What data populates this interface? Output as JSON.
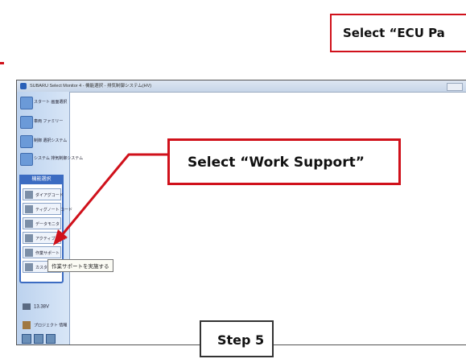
{
  "callouts": {
    "top": "Select “ECU Pa",
    "mid": "Select “Work Support”",
    "step": "Step 5"
  },
  "window": {
    "title": "SUBARU Select Monitor 4 - 機能選択 - 排気制御システム(HV)"
  },
  "sidebar": {
    "nav": [
      {
        "label": "スタート 画面選択",
        "icon": "home-icon"
      },
      {
        "label": "車両 ファミリー",
        "icon": "car-icon"
      },
      {
        "label": "制御 選択システム",
        "icon": "system-icon"
      },
      {
        "label": "システム 排気制御システム",
        "icon": "engine-icon"
      }
    ],
    "panel_title": "機能選択",
    "functions": [
      {
        "label": "ダイアグコード",
        "icon": "diag-code-icon"
      },
      {
        "label": "ティグノート コード",
        "icon": "trouble-code-icon"
      },
      {
        "label": "データモニタ",
        "icon": "data-monitor-icon"
      },
      {
        "label": "アクティブテスト",
        "icon": "active-test-icon"
      },
      {
        "label": "作業サポート",
        "icon": "work-support-icon"
      },
      {
        "label": "カスタマイズ",
        "icon": "customize-icon"
      }
    ],
    "tooltip": "作業サポートを実施する",
    "voltage": "13.38V",
    "project": "プロジェクト 情報"
  },
  "colors": {
    "callout_border": "#d0111b",
    "panel_accent": "#3c6cc2"
  }
}
